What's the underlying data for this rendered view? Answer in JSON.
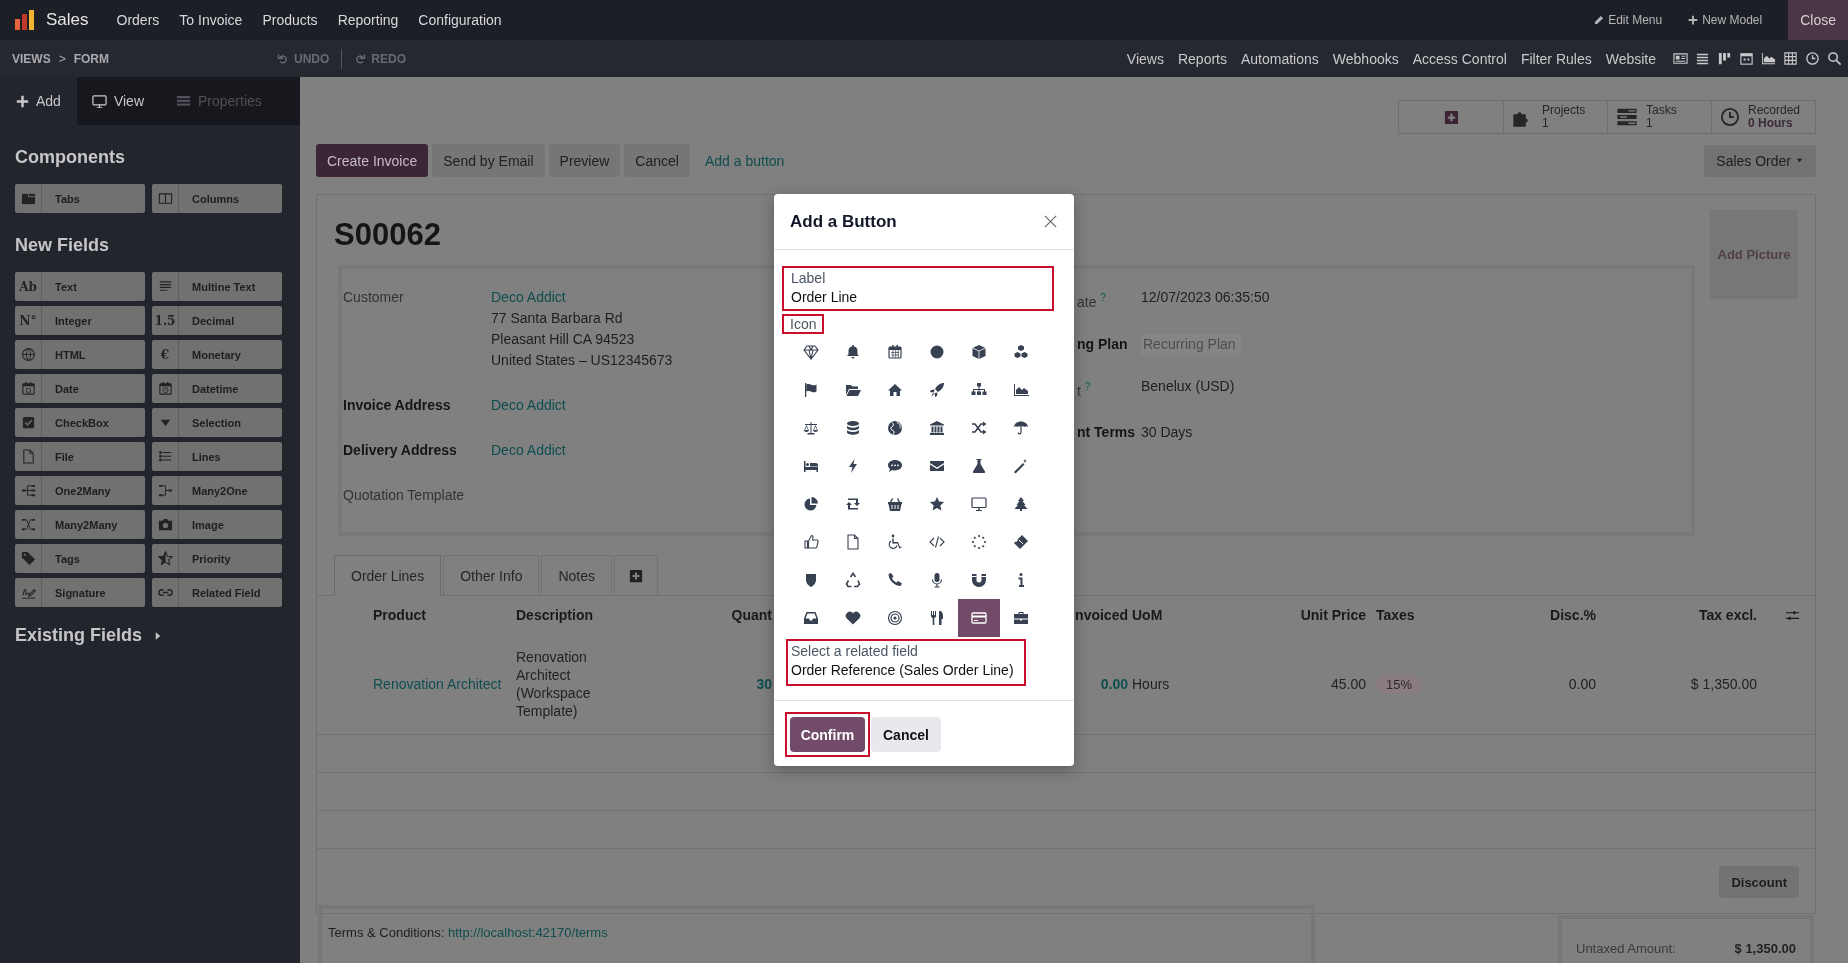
{
  "navbar": {
    "app_name": "Sales",
    "menu": [
      "Orders",
      "To Invoice",
      "Products",
      "Reporting",
      "Configuration"
    ],
    "edit_menu": "Edit Menu",
    "new_model": "New Model",
    "close": "Close"
  },
  "studio_bar": {
    "breadcrumb": [
      "VIEWS",
      "FORM"
    ],
    "separator": ">",
    "undo": {
      "label": "UNDO",
      "disabled": true
    },
    "redo": {
      "label": "REDO",
      "disabled": true
    },
    "links": [
      "Views",
      "Reports",
      "Automations",
      "Webhooks",
      "Access Control",
      "Filter Rules",
      "Website"
    ]
  },
  "sidebar": {
    "tabs": [
      {
        "label": "Add",
        "selected": true,
        "disabled": false
      },
      {
        "label": "View",
        "selected": false,
        "disabled": false
      },
      {
        "label": "Properties",
        "selected": false,
        "disabled": true
      }
    ],
    "components_title": "Components",
    "components": [
      {
        "label": "Tabs"
      },
      {
        "label": "Columns"
      }
    ],
    "new_fields_title": "New Fields",
    "new_fields": [
      {
        "label": "Text",
        "glyph": "Ab"
      },
      {
        "label": "Multine Text"
      },
      {
        "label": "Integer",
        "glyph": "N°"
      },
      {
        "label": "Decimal",
        "glyph": "1.5"
      },
      {
        "label": "HTML"
      },
      {
        "label": "Monetary",
        "glyph": "€"
      },
      {
        "label": "Date"
      },
      {
        "label": "Datetime"
      },
      {
        "label": "CheckBox"
      },
      {
        "label": "Selection"
      },
      {
        "label": "File"
      },
      {
        "label": "Lines"
      },
      {
        "label": "One2Many"
      },
      {
        "label": "Many2One"
      },
      {
        "label": "Many2Many"
      },
      {
        "label": "Image"
      },
      {
        "label": "Tags"
      },
      {
        "label": "Priority"
      },
      {
        "label": "Signature"
      },
      {
        "label": "Related Field"
      }
    ],
    "existing_fields": "Existing Fields"
  },
  "smart_buttons": [
    {
      "title": "Projects",
      "value": "1",
      "highlighted": false
    },
    {
      "title": "Tasks",
      "value": "1",
      "highlighted": false
    },
    {
      "title": "Recorded",
      "value": "0 Hours",
      "highlighted": true
    }
  ],
  "status_buttons": [
    {
      "label": "Create Invoice",
      "kind": "primary"
    },
    {
      "label": "Send by Email",
      "kind": "secondary"
    },
    {
      "label": "Preview",
      "kind": "secondary"
    },
    {
      "label": "Cancel",
      "kind": "secondary"
    },
    {
      "label": "Add a button",
      "kind": "link"
    }
  ],
  "status_menu": "Sales Order",
  "form": {
    "title": "S00062",
    "add_picture": "Add Picture",
    "left_fields": [
      {
        "label": "Customer",
        "bold": false,
        "link": "Deco Addict",
        "lines": [
          "77 Santa Barbara Rd",
          "Pleasant Hill CA 94523",
          "United States – US12345673"
        ]
      },
      {
        "label": "Invoice Address",
        "bold": true,
        "link": "Deco Addict"
      },
      {
        "label": "Delivery Address",
        "bold": true,
        "link": "Deco Addict"
      },
      {
        "label": "Quotation Template",
        "bold": false
      }
    ],
    "right_fields": [
      {
        "label": "ate $^{?}$",
        "bold": false,
        "value": "12/07/2023 06:35:50"
      },
      {
        "label": "ng Plan",
        "bold": true,
        "placeholder": "Recurring Plan"
      },
      {
        "label": "t $^{?}$",
        "bold": false,
        "value": "Benelux (USD)"
      },
      {
        "label": "nt Terms",
        "bold": true,
        "value": "30 Days"
      }
    ]
  },
  "tabs": [
    {
      "label": "Order Lines",
      "selected": true
    },
    {
      "label": "Other Info",
      "selected": false
    },
    {
      "label": "Notes",
      "selected": false
    }
  ],
  "table": {
    "columns": [
      "Product",
      "Description",
      "Quant",
      "nvoiced",
      "UoM",
      "Unit Price",
      "Taxes",
      "Disc.%",
      "Tax excl."
    ],
    "rows": [
      {
        "product": "Renovation Architect",
        "description": "Renovation Architect (Workspace Template)",
        "quantity": "30",
        "invoiced": "0.00",
        "uom": "Hours",
        "unit_price": "45.00",
        "taxes": "15%",
        "discount": "0.00",
        "subtotal": "$ 1,350.00"
      }
    ]
  },
  "discount_button": "Discount",
  "terms": {
    "label": "Terms & Conditions:",
    "link": "http://localhost:42170/terms"
  },
  "totals": [
    {
      "label": "Untaxed Amount:",
      "value": "$ 1,350.00"
    }
  ],
  "dialog": {
    "title": "Add a Button",
    "label_field": {
      "label": "Label",
      "value": "Order Line",
      "highlighted": true
    },
    "icon_label": {
      "text": "Icon",
      "highlighted": true
    },
    "icons": [
      {
        "selected": false
      },
      {
        "selected": false
      },
      {
        "selected": false
      },
      {
        "selected": false
      },
      {
        "selected": false
      },
      {
        "selected": false
      },
      {
        "selected": false
      },
      {
        "selected": false
      },
      {
        "selected": false
      },
      {
        "selected": false
      },
      {
        "selected": false
      },
      {
        "selected": false
      },
      {
        "selected": false
      },
      {
        "selected": false
      },
      {
        "selected": false
      },
      {
        "selected": false
      },
      {
        "selected": false
      },
      {
        "selected": false
      },
      {
        "selected": false
      },
      {
        "selected": false
      },
      {
        "selected": false
      },
      {
        "selected": false
      },
      {
        "selected": false
      },
      {
        "selected": false
      },
      {
        "selected": false
      },
      {
        "selected": false
      },
      {
        "selected": false
      },
      {
        "selected": false
      },
      {
        "selected": false
      },
      {
        "selected": false
      },
      {
        "selected": false
      },
      {
        "selected": false
      },
      {
        "selected": false
      },
      {
        "selected": false
      },
      {
        "selected": false
      },
      {
        "selected": false
      },
      {
        "selected": false
      },
      {
        "selected": false
      },
      {
        "selected": false
      },
      {
        "selected": false
      },
      {
        "selected": false
      },
      {
        "selected": false
      },
      {
        "selected": false
      },
      {
        "selected": false
      },
      {
        "selected": false
      },
      {
        "selected": false
      },
      {
        "selected": true
      },
      {
        "selected": false
      }
    ],
    "related_field": {
      "label": "Select a related field",
      "value": "Order Reference (Sales Order Line)",
      "highlighted": true
    },
    "confirm": {
      "label": "Confirm",
      "highlighted": true
    },
    "cancel": "Cancel"
  }
}
